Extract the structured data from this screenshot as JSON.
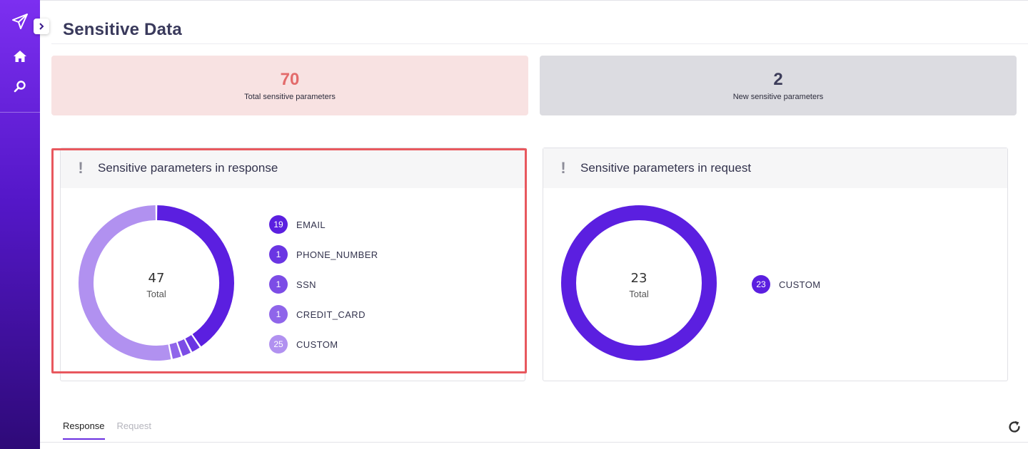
{
  "page": {
    "title": "Sensitive Data"
  },
  "sidebar": {
    "items": [
      {
        "icon": "send-icon"
      },
      {
        "icon": "home-icon"
      },
      {
        "icon": "search-icon"
      }
    ]
  },
  "stats": {
    "total": {
      "value": "70",
      "label": "Total sensitive parameters",
      "color": "#e36b6b"
    },
    "new": {
      "value": "2",
      "label": "New sensitive parameters",
      "color": "#3d3d5a"
    }
  },
  "response_panel": {
    "title": "Sensitive parameters in response",
    "total_value": "47",
    "total_label": "Total",
    "legend": [
      {
        "count": "19",
        "name": "EMAIL",
        "color": "#5b1fe0"
      },
      {
        "count": "1",
        "name": "PHONE_NUMBER",
        "color": "#6a35e3"
      },
      {
        "count": "1",
        "name": "SSN",
        "color": "#7c4ce6"
      },
      {
        "count": "1",
        "name": "CREDIT_CARD",
        "color": "#8f65ea"
      },
      {
        "count": "25",
        "name": "CUSTOM",
        "color": "#b191f0"
      }
    ]
  },
  "request_panel": {
    "title": "Sensitive parameters in request",
    "total_value": "23",
    "total_label": "Total",
    "legend": [
      {
        "count": "23",
        "name": "CUSTOM",
        "color": "#5b1fe0"
      }
    ]
  },
  "tabs": [
    {
      "label": "Response",
      "active": true
    },
    {
      "label": "Request",
      "active": false
    }
  ],
  "colors": {
    "accent": "#6a2fe0",
    "highlight": "#e8585e"
  }
}
